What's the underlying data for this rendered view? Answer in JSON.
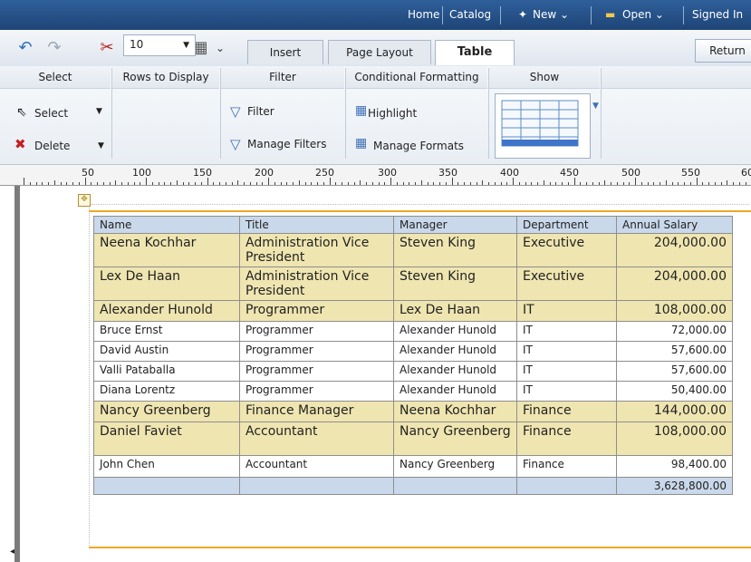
{
  "topbar": {
    "home": "Home",
    "catalog": "Catalog",
    "new": "New ⌄",
    "open": "Open ⌄",
    "signed_in": "Signed In"
  },
  "toolbar": {
    "tabs": [
      {
        "label": "Insert"
      },
      {
        "label": "Page Layout"
      },
      {
        "label": "Table"
      }
    ],
    "return_label": "Return"
  },
  "ribbon": {
    "groups": {
      "select": "Select",
      "rows_to_display": "Rows to Display",
      "filter": "Filter",
      "conditional_formatting": "Conditional Formatting",
      "show": "Show"
    },
    "select_btn": "Select",
    "delete_btn": "Delete",
    "rows_value": "10",
    "filter_btn": "Filter",
    "manage_filters_btn": "Manage Filters",
    "highlight_btn": "Highlight",
    "manage_formats_btn": "Manage Formats"
  },
  "ruler": {
    "labels": [
      "50",
      "100",
      "150",
      "200",
      "250",
      "300",
      "350",
      "400",
      "450",
      "500",
      "550",
      "60"
    ]
  },
  "table": {
    "headers": [
      "Name",
      "Title",
      "Manager",
      "Department",
      "Annual Salary"
    ],
    "rows": [
      {
        "name": "Neena Kochhar",
        "title": "Administration Vice President",
        "manager": "Steven King",
        "department": "Executive",
        "salary": "204,000.00",
        "highlight": true
      },
      {
        "name": "Lex De Haan",
        "title": "Administration Vice President",
        "manager": "Steven King",
        "department": "Executive",
        "salary": "204,000.00",
        "highlight": true
      },
      {
        "name": "Alexander Hunold",
        "title": "Programmer",
        "manager": "Lex De Haan",
        "department": "IT",
        "salary": "108,000.00",
        "highlight": true
      },
      {
        "name": "Bruce Ernst",
        "title": "Programmer",
        "manager": "Alexander Hunold",
        "department": "IT",
        "salary": "72,000.00",
        "highlight": false
      },
      {
        "name": "David Austin",
        "title": "Programmer",
        "manager": "Alexander Hunold",
        "department": "IT",
        "salary": "57,600.00",
        "highlight": false
      },
      {
        "name": "Valli Pataballa",
        "title": "Programmer",
        "manager": "Alexander Hunold",
        "department": "IT",
        "salary": "57,600.00",
        "highlight": false
      },
      {
        "name": "Diana Lorentz",
        "title": "Programmer",
        "manager": "Alexander Hunold",
        "department": "IT",
        "salary": "50,400.00",
        "highlight": false
      },
      {
        "name": "Nancy Greenberg",
        "title": "Finance Manager",
        "manager": "Neena Kochhar",
        "department": "Finance",
        "salary": "144,000.00",
        "highlight": true
      },
      {
        "name": "Daniel Faviet",
        "title": "Accountant",
        "manager": "Nancy Greenberg",
        "department": "Finance",
        "salary": "108,000.00",
        "highlight": true
      },
      {
        "name": "John Chen",
        "title": "Accountant",
        "manager": "Nancy Greenberg",
        "department": "Finance",
        "salary": "98,400.00",
        "highlight": false
      }
    ],
    "total": "3,628,800.00"
  },
  "colors": {
    "topbar": "#1e4577",
    "highlight_row": "#efe5b0",
    "header_row": "#c9d8ea",
    "selection_border": "#f1a626"
  }
}
